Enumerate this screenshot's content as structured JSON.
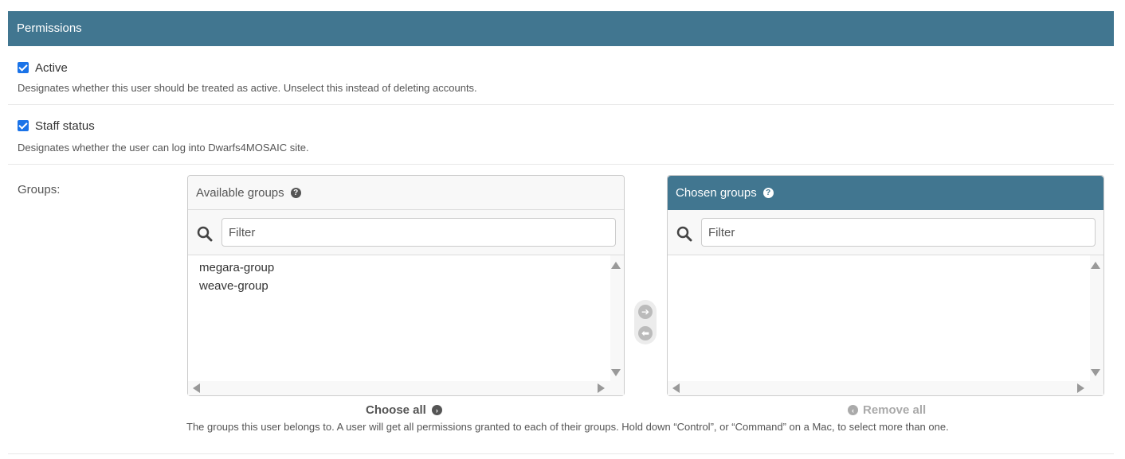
{
  "section": {
    "title": "Permissions"
  },
  "active": {
    "label": "Active",
    "checked": true,
    "help": "Designates whether this user should be treated as active. Unselect this instead of deleting accounts."
  },
  "staff": {
    "label": "Staff status",
    "checked": true,
    "help": "Designates whether the user can log into Dwarfs4MOSAIC site."
  },
  "groups": {
    "label": "Groups:",
    "available": {
      "title": "Available groups",
      "filter_placeholder": "Filter",
      "options": [
        "megara-group",
        "weave-group"
      ]
    },
    "chosen": {
      "title": "Chosen groups",
      "filter_placeholder": "Filter",
      "options": []
    },
    "choose_all": "Choose all",
    "remove_all": "Remove all",
    "help": "The groups this user belongs to. A user will get all permissions granted to each of their groups. Hold down “Control”, or “Command” on a Mac, to select more than one."
  },
  "icons": {
    "help": "question-circle-icon",
    "search": "search-icon",
    "add": "arrow-right-circle-icon",
    "remove": "arrow-left-circle-icon"
  },
  "colors": {
    "header": "#417690",
    "checkbox": "#1a73e8"
  }
}
